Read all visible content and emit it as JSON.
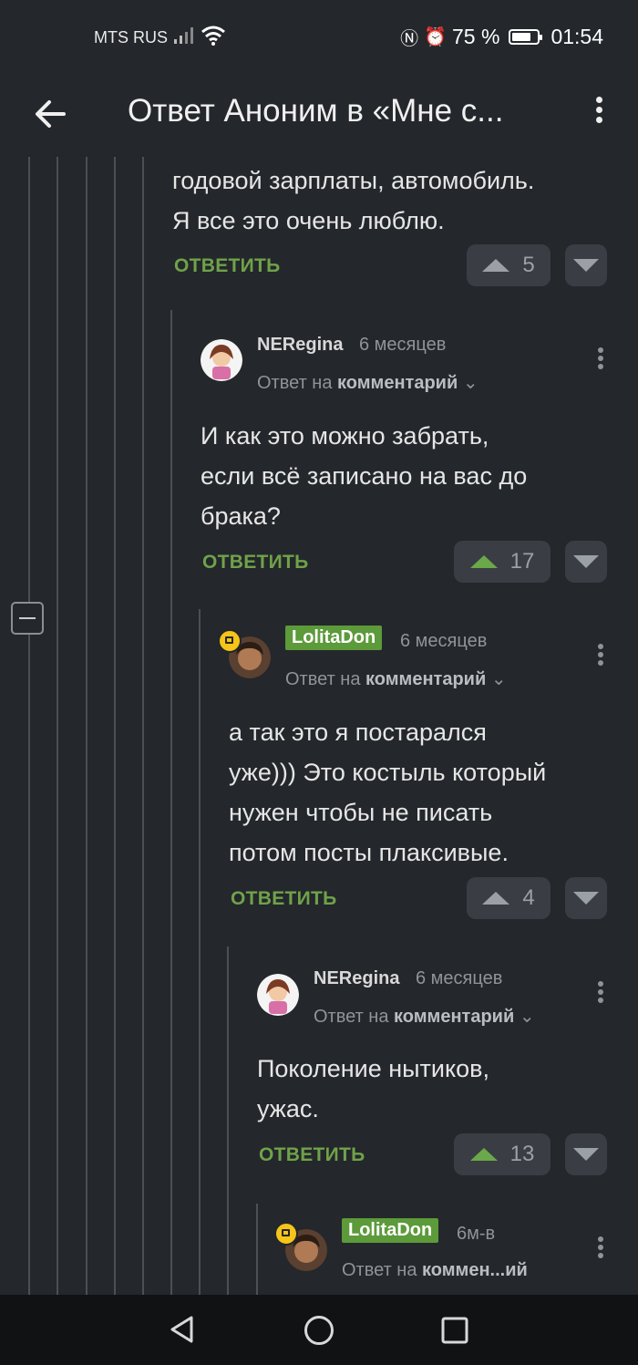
{
  "status": {
    "carrier": "MTS RUS",
    "battery": "75 %",
    "battery_level": 0.75,
    "time": "01:54"
  },
  "appbar": {
    "title": "Ответ Аноним в «Мне с...",
    "back_icon": "arrow-left-icon",
    "menu_icon": "more-vertical-icon"
  },
  "comments": [
    {
      "text": [
        "годовой зарплаты, автомобиль.",
        "Я все это очень люблю."
      ],
      "reply_label": "ОТВЕТИТЬ",
      "votes": "5",
      "upvoted": false
    },
    {
      "author": "NERegina",
      "time": "6 месяцев",
      "reply_prefix": "Ответ на",
      "reply_target": "комментарий",
      "text": [
        "И как это можно забрать,",
        "если всё записано на вас до",
        "брака?"
      ],
      "reply_label": "ОТВЕТИТЬ",
      "votes": "17",
      "upvoted": true
    },
    {
      "author": "LolitaDon",
      "time": "6 месяцев",
      "reply_prefix": "Ответ на",
      "reply_target": "комментарий",
      "text": [
        "а так это я постарался",
        "уже))) Это костыль который",
        "нужен чтобы не писать",
        "потом посты плаксивые."
      ],
      "reply_label": "ОТВЕТИТЬ",
      "votes": "4",
      "upvoted": false
    },
    {
      "author": "NERegina",
      "time": "6 месяцев",
      "reply_prefix": "Ответ на",
      "reply_target": "комментарий",
      "text": [
        "Поколение нытиков,",
        "ужас."
      ],
      "reply_label": "ОТВЕТИТЬ",
      "votes": "13",
      "upvoted": true
    },
    {
      "author": "LolitaDon",
      "time": "6м-в",
      "reply_prefix": "Ответ на",
      "reply_target": "коммен...ий"
    }
  ],
  "colors": {
    "background": "#24272b",
    "accent_green": "#6fa24a",
    "badge_green": "#5c9a3a"
  }
}
